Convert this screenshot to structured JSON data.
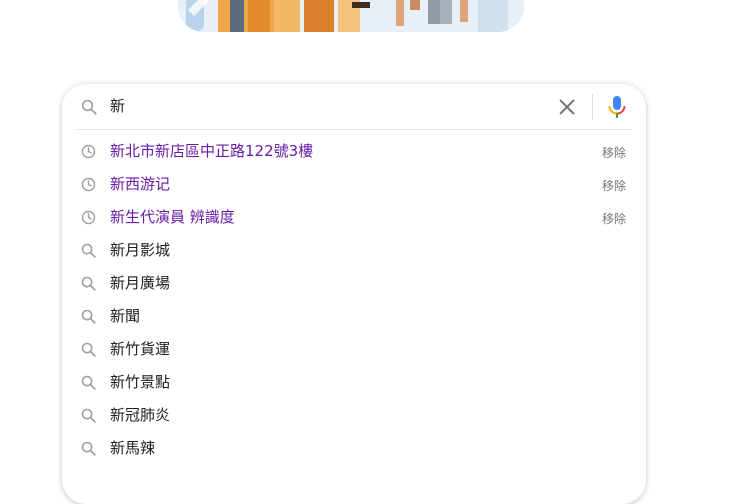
{
  "search": {
    "query": "新"
  },
  "suggestions": [
    {
      "type": "history",
      "text": "新北市新店區中正路122號3樓",
      "remove_label": "移除"
    },
    {
      "type": "history",
      "text": "新西游记",
      "remove_label": "移除"
    },
    {
      "type": "history",
      "text": "新生代演員 辨識度",
      "remove_label": "移除"
    },
    {
      "type": "search",
      "text": "新月影城"
    },
    {
      "type": "search",
      "text": "新月廣場"
    },
    {
      "type": "search",
      "text": "新聞"
    },
    {
      "type": "search",
      "text": "新竹貨運"
    },
    {
      "type": "search",
      "text": "新竹景點"
    },
    {
      "type": "search",
      "text": "新冠肺炎"
    },
    {
      "type": "search",
      "text": "新馬辣"
    }
  ],
  "icons": {
    "search": "search-icon",
    "history": "history-clock-icon",
    "clear": "close-icon",
    "mic": "microphone-icon"
  },
  "colors": {
    "history_text": "#681da8",
    "text": "#202124",
    "icon": "#9aa0a6"
  }
}
